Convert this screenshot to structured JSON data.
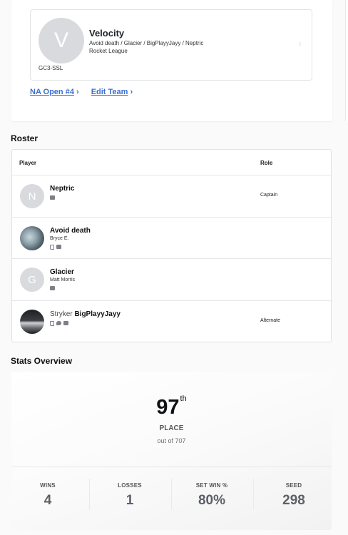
{
  "team": {
    "avatar_letter": "V",
    "tag": "GC3-SSL",
    "name": "Velocity",
    "members": "Avoid death / Glacier / BigPlayyJayy / Neptric",
    "game": "Rocket League",
    "links": [
      {
        "label": "NA Open #4"
      },
      {
        "label": "Edit Team"
      }
    ]
  },
  "roster": {
    "title": "Roster",
    "columns": {
      "player": "Player",
      "role": "Role"
    },
    "players": [
      {
        "avatar_letter": "N",
        "prefix": "",
        "name": "Neptric",
        "real_name": "",
        "role": "Captain",
        "icons": [
          "discord-icon"
        ]
      },
      {
        "avatar_letter": "",
        "prefix": "",
        "name": "Avoid death",
        "real_name": "Bryce E.",
        "role": "",
        "icons": [
          "twitch-icon",
          "discord-icon"
        ]
      },
      {
        "avatar_letter": "G",
        "prefix": "",
        "name": "Glacier",
        "real_name": "Matt Morris",
        "role": "",
        "icons": [
          "discord-icon"
        ]
      },
      {
        "avatar_letter": "",
        "prefix": "Stryker",
        "name": "BigPlayyJayy",
        "real_name": "",
        "role": "Alternate",
        "icons": [
          "twitch-icon",
          "twitter-icon",
          "discord-icon"
        ]
      }
    ]
  },
  "stats": {
    "title": "Stats Overview",
    "place": "97",
    "place_suffix": "th",
    "place_label": "PLACE",
    "place_sub": "out of 707",
    "items": [
      {
        "label": "WINS",
        "value": "4"
      },
      {
        "label": "LOSSES",
        "value": "1"
      },
      {
        "label": "SET WIN %",
        "value": "80%"
      },
      {
        "label": "SEED",
        "value": "298"
      }
    ]
  }
}
